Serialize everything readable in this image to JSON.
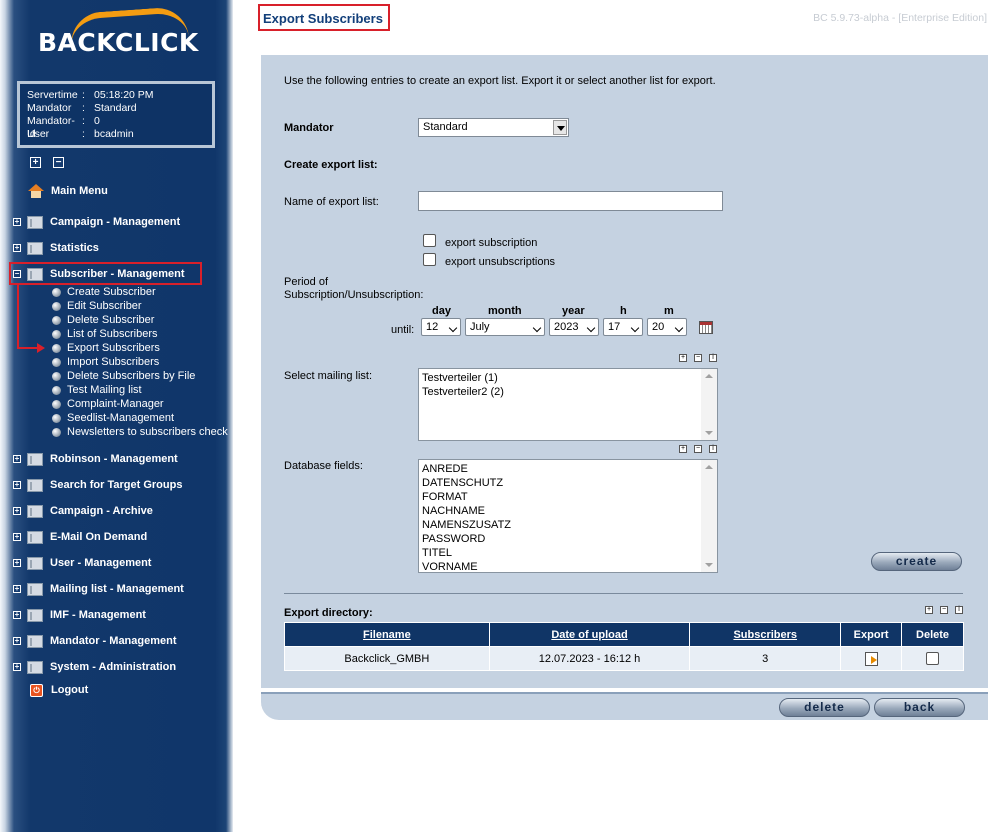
{
  "sidebar": {
    "logo_text": "BACKCLICK",
    "info": [
      {
        "key": "Servertime",
        "value": "05:18:20 PM"
      },
      {
        "key": "Mandator",
        "value": "Standard"
      },
      {
        "key": "Mandator-Id",
        "value": "0"
      },
      {
        "key": "User",
        "value": "bcadmin"
      }
    ],
    "main_menu": "Main Menu",
    "nav": {
      "campaign_management": "Campaign - Management",
      "statistics": "Statistics",
      "subscriber_management": "Subscriber - Management",
      "robinson_management": "Robinson - Management",
      "search_target_groups": "Search for Target Groups",
      "campaign_archive": "Campaign - Archive",
      "email_on_demand": "E-Mail On Demand",
      "user_management": "User - Management",
      "mailing_list_management": "Mailing list - Management",
      "imf_management": "IMF - Management",
      "mandator_management": "Mandator - Management",
      "system_administration": "System - Administration",
      "logout": "Logout"
    },
    "sub_items": [
      "Create Subscriber",
      "Edit Subscriber",
      "Delete Subscriber",
      "List of Subscribers",
      "Export Subscribers",
      "Import Subscribers",
      "Delete Subscribers by File",
      "Test Mailing list",
      "Complaint-Manager",
      "Seedlist-Management",
      "Newsletters to subscribers check"
    ]
  },
  "header": {
    "title": "Export Subscribers",
    "version": "BC 5.9.73-alpha - [Enterprise Edition]"
  },
  "form": {
    "intro": "Use the following entries to create an export list. Export it or select another list for export.",
    "mandator_label": "Mandator",
    "mandator_value": "Standard",
    "create_heading": "Create export list:",
    "name_label": "Name of export list:",
    "name_value": "",
    "export_subscription": "export subscription",
    "export_unsubscription": "export unsubscriptions",
    "period_label_1": "Period of",
    "period_label_2": "Subscription/Unsubscription:",
    "date_headers": {
      "day": "day",
      "month": "month",
      "year": "year",
      "h": "h",
      "m": "m"
    },
    "until_label": "until:",
    "date_values": {
      "day": "12",
      "month": "July",
      "year": "2023",
      "h": "17",
      "m": "20"
    },
    "mailing_list_label": "Select mailing list:",
    "mailing_lists": [
      "Testverteiler (1)",
      "Testverteiler2 (2)"
    ],
    "db_fields_label": "Database fields:",
    "db_fields": [
      "ANREDE",
      "DATENSCHUTZ",
      "FORMAT",
      "NACHNAME",
      "NAMENSZUSATZ",
      "PASSWORD",
      "TITEL",
      "VORNAME"
    ],
    "create_button": "create"
  },
  "export_directory": {
    "heading": "Export directory:",
    "columns": [
      "Filename",
      "Date of upload",
      "Subscribers",
      "Export",
      "Delete"
    ],
    "rows": [
      {
        "filename": "Backclick_GMBH",
        "date": "12.07.2023 - 16:12 h",
        "subscribers": "3"
      }
    ]
  },
  "footer": {
    "delete_button": "delete",
    "back_button": "back"
  },
  "colors": {
    "sidebar_bg": "#10366a",
    "panel_bg": "#c5d2e1",
    "table_header": "#103566",
    "highlight": "#d8202a",
    "title_color": "#123f7a"
  }
}
